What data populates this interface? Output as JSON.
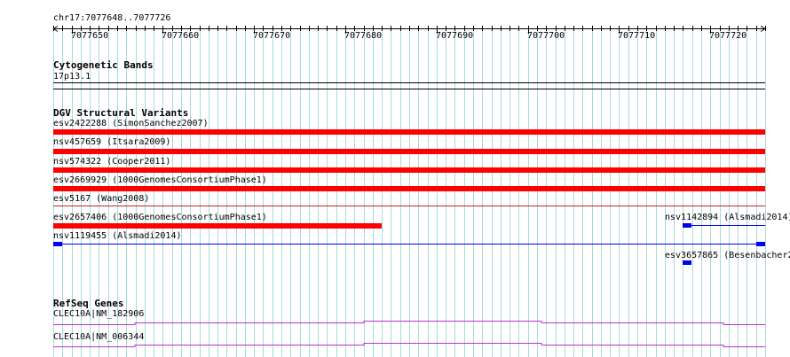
{
  "ruler": {
    "location": "chr17:7077648..7077726",
    "start": 7077648,
    "end": 7077726,
    "ticks": [
      "7077650",
      "7077660",
      "7077670",
      "7077680",
      "7077690",
      "7077700",
      "7077710",
      "7077720"
    ]
  },
  "tracks": {
    "cytoband": {
      "title": "Cytogenetic Bands",
      "band": "17p13.1"
    },
    "dgv": {
      "title": "DGV Structural Variants",
      "features": [
        {
          "label": "esv2422288 (SimonSanchez2007)",
          "start": 7077648,
          "end": 7077726,
          "style": "thick",
          "color": "#ff0000"
        },
        {
          "label": "nsv457659 (Itsara2009)",
          "start": 7077648,
          "end": 7077726,
          "style": "thick",
          "color": "#ff0000"
        },
        {
          "label": "nsv574322 (Cooper2011)",
          "start": 7077648,
          "end": 7077726,
          "style": "thick",
          "color": "#ff0000"
        },
        {
          "label": "esv2669929 (1000GenomesConsortiumPhase1)",
          "start": 7077648,
          "end": 7077726,
          "style": "thick",
          "color": "#ff0000"
        },
        {
          "label": "esv5167 (Wang2008)",
          "start": 7077648,
          "end": 7077726,
          "style": "thin",
          "color": "#cc2222"
        },
        {
          "label": "esv2657406 (1000GenomesConsortiumPhase1)",
          "start": 7077648,
          "end": 7077684,
          "style": "thick",
          "color": "#ff0000"
        },
        {
          "label": "nsv1142894 (Alsmadi2014)",
          "start": 7077717,
          "end": 7077726,
          "style": "box-line",
          "color": "#0000ee"
        },
        {
          "label": "nsv1119455 (Alsmadi2014)",
          "start": 7077648,
          "end": 7077726,
          "style": "box-ends",
          "color": "#0000ee"
        },
        {
          "label": "esv3657865 (Besenbacher2",
          "start": 7077717,
          "end": 7077718,
          "style": "box",
          "color": "#0000ee"
        }
      ]
    },
    "refseq": {
      "title": "RefSeq Genes",
      "features": [
        {
          "label": "CLEC10A|NM_182906",
          "color": "#bb33cc"
        },
        {
          "label": "CLEC10A|NM_006344",
          "color": "#bb33cc"
        }
      ]
    }
  }
}
